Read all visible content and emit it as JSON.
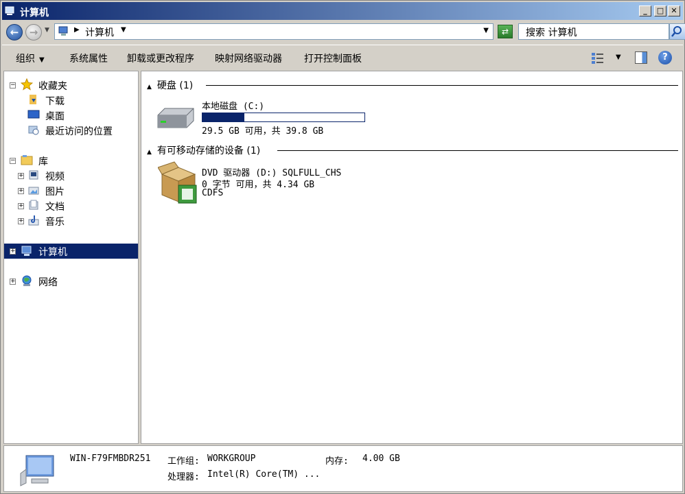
{
  "window": {
    "title": "计算机"
  },
  "address": {
    "crumb": "计算机",
    "search_placeholder": "搜索 计算机"
  },
  "toolbar": {
    "organize": "组织",
    "system_properties": "系统属性",
    "uninstall": "卸载或更改程序",
    "map_drive": "映射网络驱动器",
    "control_panel": "打开控制面板"
  },
  "nav": {
    "favorites": "收藏夹",
    "downloads": "下载",
    "desktop": "桌面",
    "recent": "最近访问的位置",
    "libraries": "库",
    "videos": "视频",
    "pictures": "图片",
    "documents": "文档",
    "music": "音乐",
    "computer": "计算机",
    "network": "网络"
  },
  "groups": {
    "hdd_header": "硬盘 (1)",
    "removable_header": "有可移动存储的设备 (1)"
  },
  "drives": [
    {
      "name": "本地磁盘 (C:)",
      "space": "29.5 GB 可用，共 39.8 GB",
      "used_fraction": 0.26
    },
    {
      "name": "DVD 驱动器 (D:) SQLFULL_CHS",
      "space": "0 字节 可用，共 4.34 GB",
      "fs": "CDFS"
    }
  ],
  "details": {
    "computer_name": "WIN-F79FMBDR251",
    "workgroup_label": "工作组:",
    "workgroup": "WORKGROUP",
    "memory_label": "内存:",
    "memory": "4.00 GB",
    "processor_label": "处理器:",
    "processor": "Intel(R) Core(TM) ..."
  },
  "colors": {
    "selection": "#0a246a",
    "titlebar_start": "#0a246a",
    "titlebar_end": "#a6caf0"
  }
}
